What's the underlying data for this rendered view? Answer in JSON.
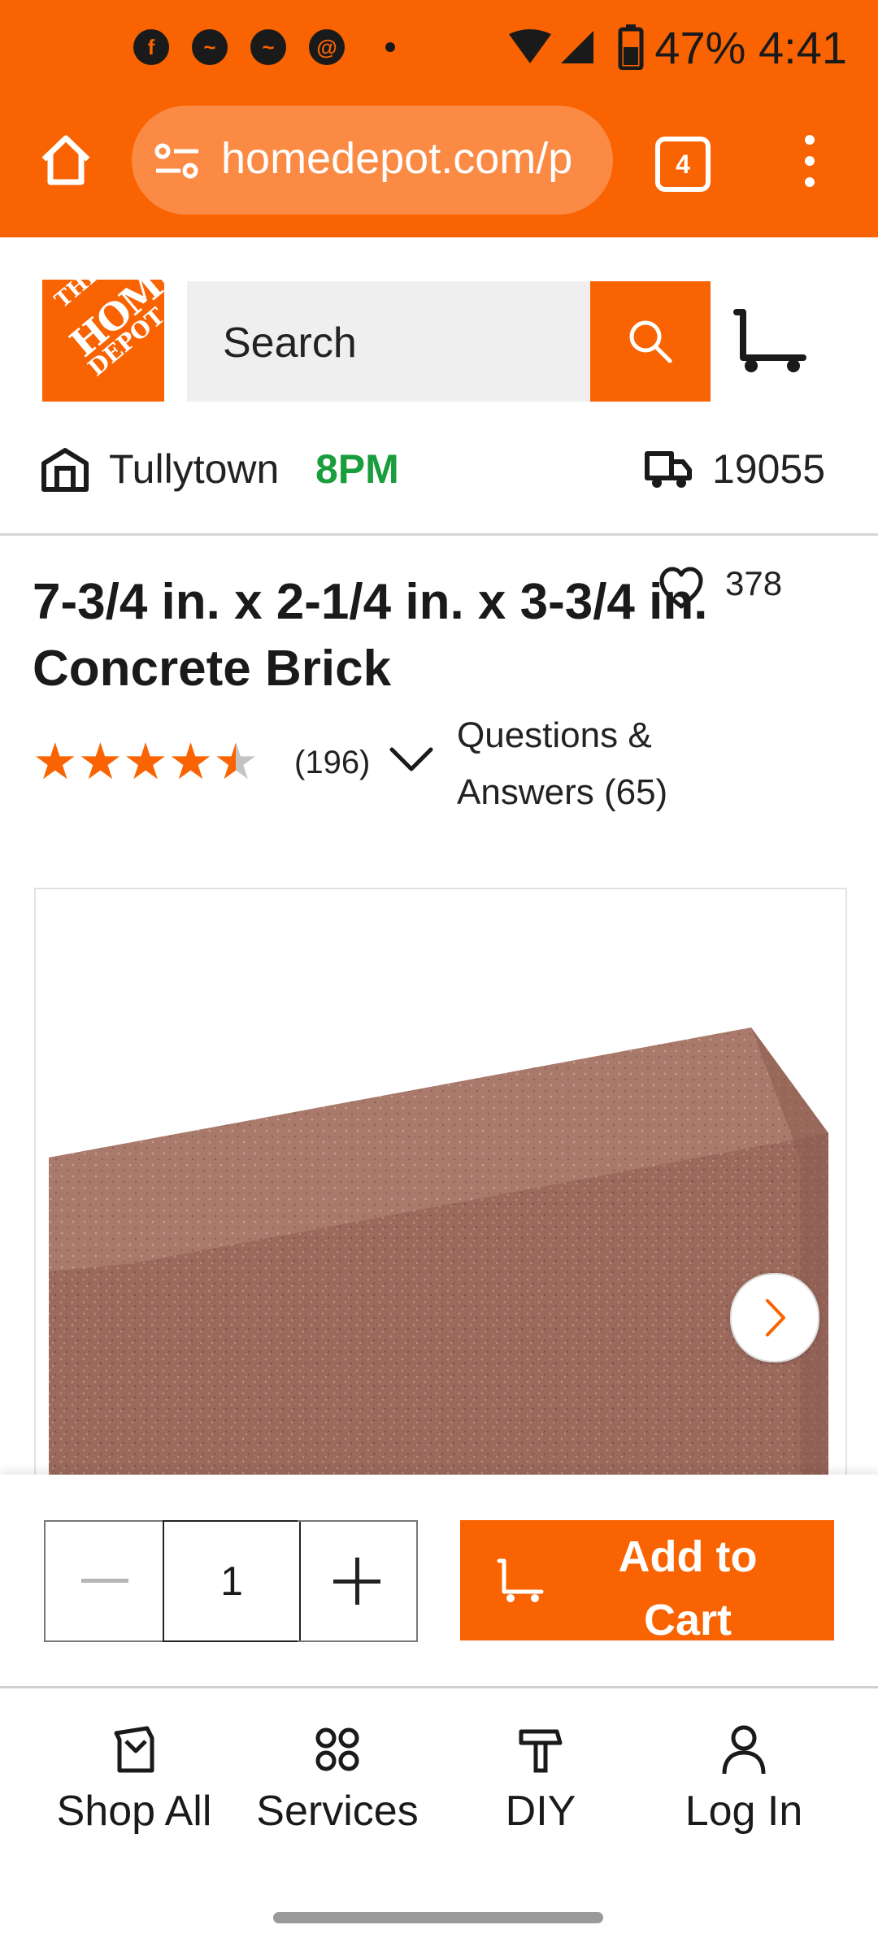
{
  "status_bar": {
    "battery": "47%",
    "time": "4:41",
    "notification_icons": [
      "facebook-icon",
      "messenger-icon",
      "messenger-icon",
      "threads-icon"
    ]
  },
  "browser": {
    "url": "homedepot.com/p",
    "tab_count": "4"
  },
  "header": {
    "logo_lines": [
      "THE",
      "HOME",
      "DEPOT"
    ],
    "search_placeholder": "Search"
  },
  "store": {
    "name": "Tullytown",
    "hours": "8PM",
    "zip": "19055"
  },
  "product": {
    "title": "7-3/4 in. x 2-1/4 in. x 3-3/4 in. Concrete Brick",
    "favorites_count": "378",
    "rating": 4.5,
    "review_count": "(196)",
    "qa_label": "Questions & Answers (65)"
  },
  "buy_bar": {
    "quantity": "1",
    "add_to_cart": "Add to Cart"
  },
  "bottom_nav": [
    {
      "label": "Shop All",
      "icon": "shop-all-icon"
    },
    {
      "label": "Services",
      "icon": "services-icon"
    },
    {
      "label": "DIY",
      "icon": "diy-icon"
    },
    {
      "label": "Log In",
      "icon": "person-icon"
    }
  ],
  "colors": {
    "brand_orange": "#f96302",
    "store_hours_green": "#1a9d3c"
  }
}
